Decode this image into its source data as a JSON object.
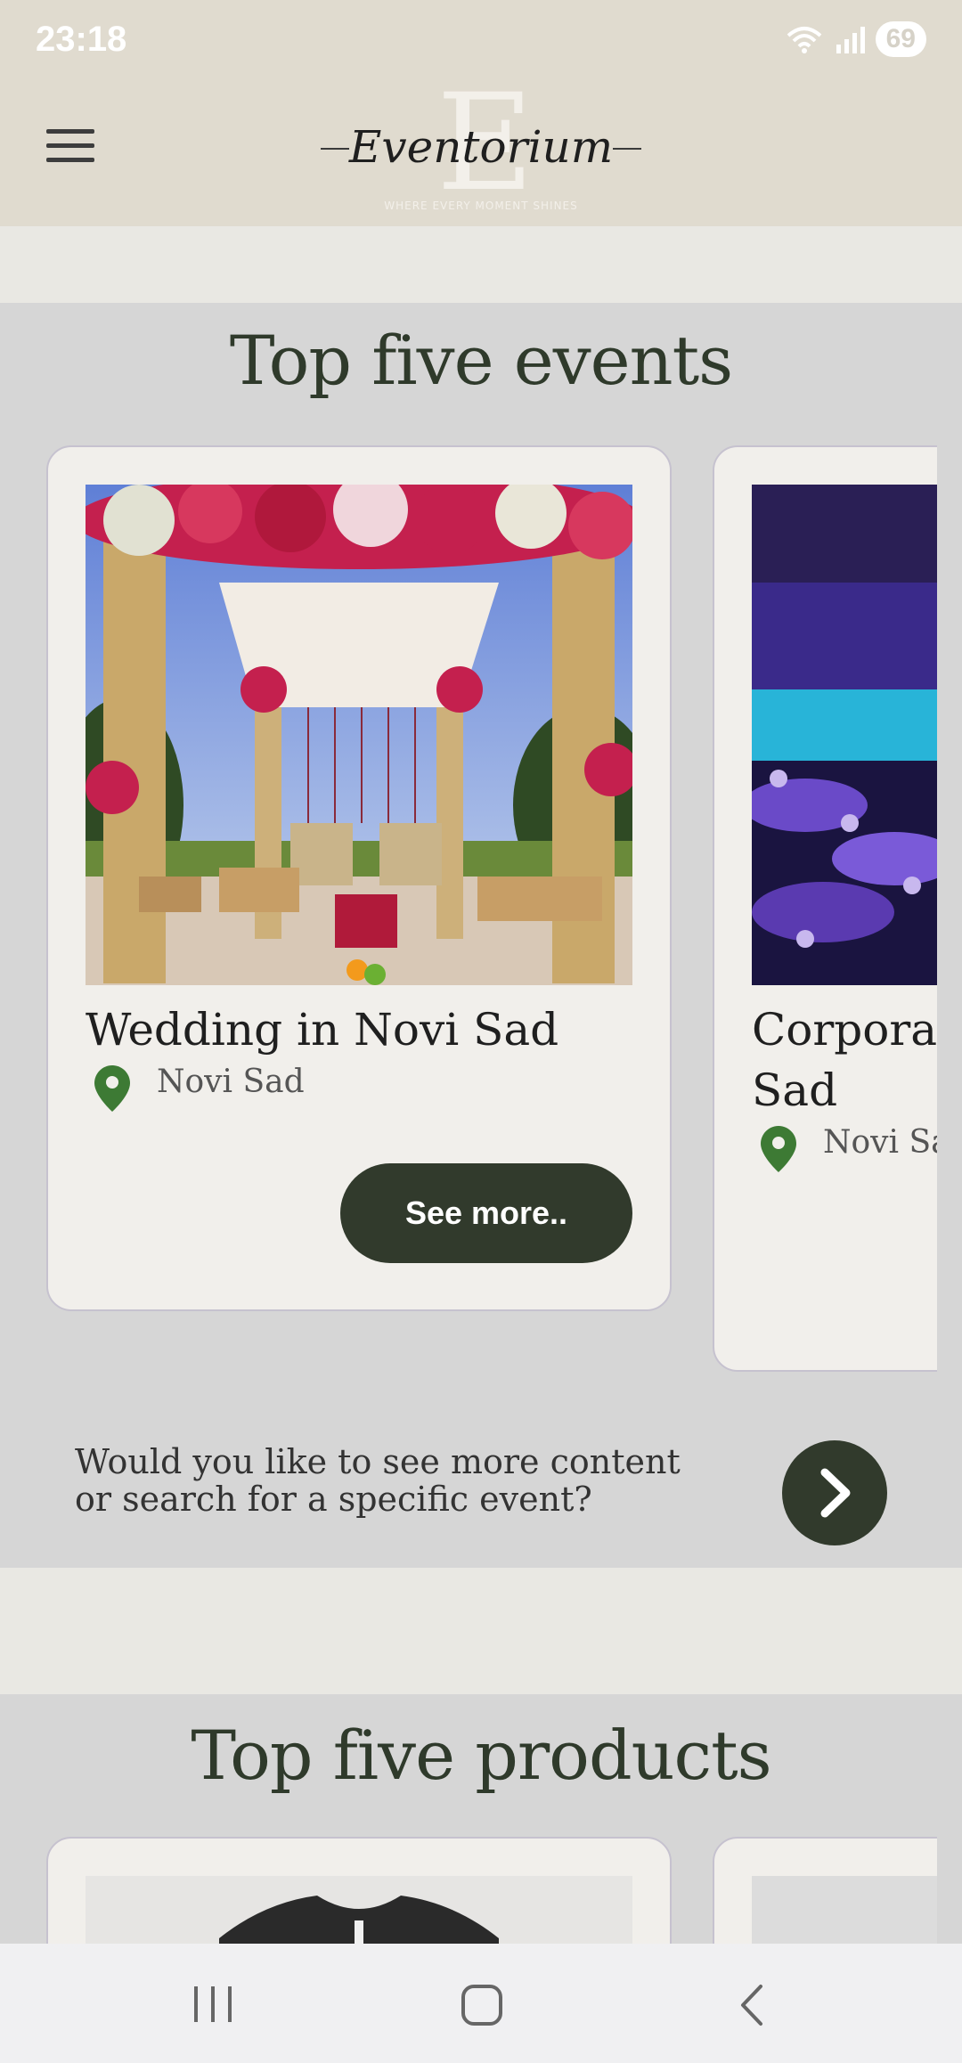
{
  "status_bar": {
    "time": "23:18",
    "battery": "69"
  },
  "header": {
    "logo_text": "Eventorium",
    "logo_tagline": "WHERE EVERY MOMENT SHINES",
    "logo_letter": "E",
    "menu_icon": "hamburger-menu-icon"
  },
  "events_section": {
    "title": "Top five events",
    "cards": [
      {
        "title": "Wedding in Novi Sad",
        "location": "Novi Sad",
        "button_label": "See more.."
      },
      {
        "title_line1": "Corporate",
        "title_line2": "Sad",
        "location": "Novi Sa"
      }
    ],
    "prompt_text": "Would you like to see more content or search for a specific event?",
    "next_icon": "chevron-right-icon"
  },
  "products_section": {
    "title": "Top five products"
  },
  "colors": {
    "accent": "#313a2c",
    "header_bg": "#e0dbcf",
    "section_bg": "#d6d6d6",
    "card_bg": "#f1efeb",
    "pin": "#3d7a34"
  }
}
